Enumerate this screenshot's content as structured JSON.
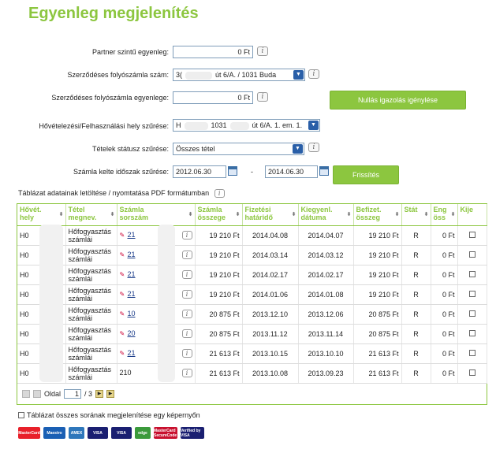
{
  "page": {
    "title": "Egyenleg megjelenítés"
  },
  "form": {
    "partner_balance_label": "Partner szintű egyenleg:",
    "partner_balance_value": "0 Ft",
    "account_label": "Szerződéses folyószámla szám:",
    "account_value_a": "3(",
    "account_value_b": "út 6/A. / 1031 Buda",
    "contract_balance_label": "Szerződéses folyószámla egyenlege:",
    "contract_balance_value": "0 Ft",
    "zero_certificate_button": "Nullás igazolás igénylése",
    "site_filter_label": "Hővételezési/Felhasználási hely szűrése:",
    "site_value_a": "H",
    "site_value_b": "1031",
    "site_value_c": "út 6/A. 1. em. 1.",
    "status_filter_label": "Tételek státusz szűrése:",
    "status_value": "Összes tétel",
    "period_label": "Számla kelte időszak szűrése:",
    "date_from": "2012.06.30",
    "date_separator": "-",
    "date_to": "2014.06.30",
    "refresh_button": "Frissítés"
  },
  "export_label": "Táblázat adatainak letöltése / nyomtatása PDF formátumban",
  "table": {
    "headers": [
      {
        "line1": "Hővét.",
        "line2": "hely"
      },
      {
        "line1": "Tétel",
        "line2": "megnev."
      },
      {
        "line1": "Számla",
        "line2": "sorszám"
      },
      {
        "line1": "Számla",
        "line2": "összege"
      },
      {
        "line1": "Fizetési",
        "line2": "határidő"
      },
      {
        "line1": "Kiegyenl.",
        "line2": "dátuma"
      },
      {
        "line1": "Befizet.",
        "line2": "összeg"
      },
      {
        "line1": "Stát",
        "line2": ""
      },
      {
        "line1": "Eng",
        "line2": "öss"
      },
      {
        "line1": "Kije",
        "line2": ""
      }
    ],
    "rows": [
      {
        "place": "H0",
        "name1": "Hőfogyasztás",
        "name2": "számlái",
        "invoice": "21",
        "amount": "19 210 Ft",
        "due": "2014.04.08",
        "settled": "2014.04.07",
        "paid": "19 210 Ft",
        "status": "R",
        "eng": "0 Ft"
      },
      {
        "place": "H0",
        "name1": "Hőfogyasztás",
        "name2": "számlái",
        "invoice": "21",
        "amount": "19 210 Ft",
        "due": "2014.03.14",
        "settled": "2014.03.12",
        "paid": "19 210 Ft",
        "status": "R",
        "eng": "0 Ft"
      },
      {
        "place": "H0",
        "name1": "Hőfogyasztás",
        "name2": "számlái",
        "invoice": "21",
        "amount": "19 210 Ft",
        "due": "2014.02.17",
        "settled": "2014.02.17",
        "paid": "19 210 Ft",
        "status": "R",
        "eng": "0 Ft"
      },
      {
        "place": "H0",
        "name1": "Hőfogyasztás",
        "name2": "számlái",
        "invoice": "21",
        "amount": "19 210 Ft",
        "due": "2014.01.06",
        "settled": "2014.01.08",
        "paid": "19 210 Ft",
        "status": "R",
        "eng": "0 Ft"
      },
      {
        "place": "H0",
        "name1": "Hőfogyasztás",
        "name2": "számlái",
        "invoice": "10",
        "amount": "20 875 Ft",
        "due": "2013.12.10",
        "settled": "2013.12.06",
        "paid": "20 875 Ft",
        "status": "R",
        "eng": "0 Ft"
      },
      {
        "place": "H0",
        "name1": "Hőfogyasztás",
        "name2": "számlái",
        "invoice": "20",
        "amount": "20 875 Ft",
        "due": "2013.11.12",
        "settled": "2013.11.14",
        "paid": "20 875 Ft",
        "status": "R",
        "eng": "0 Ft"
      },
      {
        "place": "H0",
        "name1": "Hőfogyasztás",
        "name2": "számlái",
        "invoice": "21",
        "amount": "21 613 Ft",
        "due": "2013.10.15",
        "settled": "2013.10.10",
        "paid": "21 613 Ft",
        "status": "R",
        "eng": "0 Ft"
      },
      {
        "place": "H0",
        "name1": "Hőfogyasztás",
        "name2": "számlái",
        "invoice": "210",
        "amount": "21 613 Ft",
        "due": "2013.10.08",
        "settled": "2013.09.23",
        "paid": "21 613 Ft",
        "status": "R",
        "eng": "0 Ft"
      }
    ]
  },
  "pager": {
    "label": "Oldal",
    "current": "1",
    "total": "/ 3"
  },
  "show_all_label": "Táblázat összes sorának megjelenítése egy képernyőn",
  "payment_logos": [
    {
      "text": "MasterCard",
      "color": "#e8202a"
    },
    {
      "text": "Maestro",
      "color": "#1a5fb4"
    },
    {
      "text": "AMEX",
      "color": "#2e77bb"
    },
    {
      "text": "VISA",
      "color": "#1a1f71"
    },
    {
      "text": "VISA",
      "color": "#1a1f71"
    },
    {
      "text": "edge",
      "color": "#3b9a3b"
    },
    {
      "text": "MasterCard SecureCode",
      "color": "#c8102e"
    },
    {
      "text": "Verified by VISA",
      "color": "#1a1f71"
    }
  ]
}
